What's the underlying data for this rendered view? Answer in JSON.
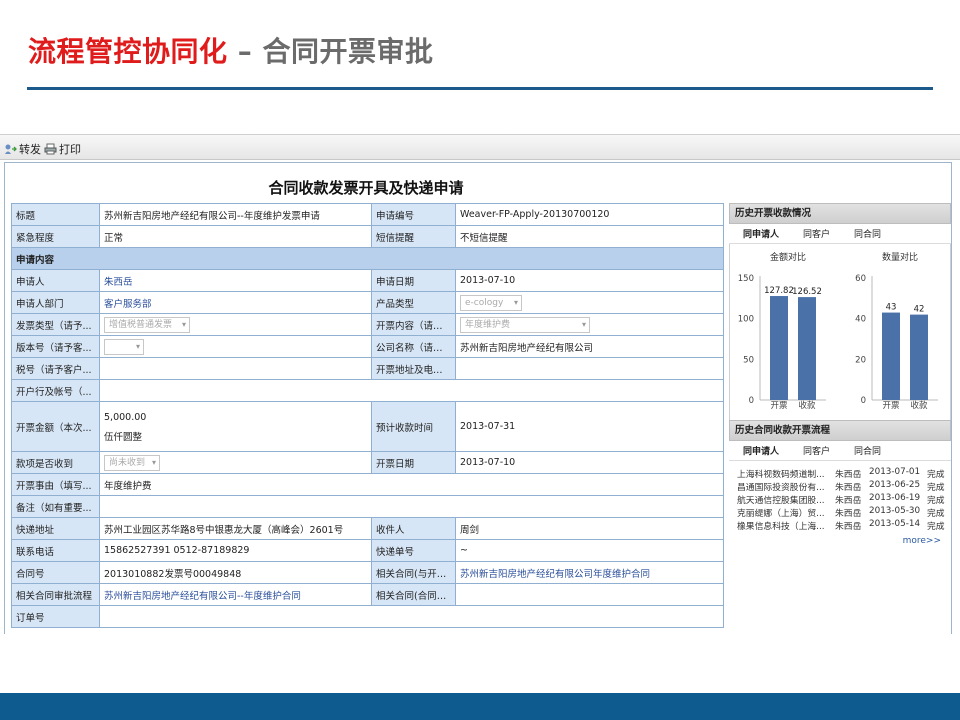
{
  "slide": {
    "title_red": "流程管控协同化",
    "title_gray": " – 合同开票审批"
  },
  "toolbar": {
    "forward_label": "转发",
    "print_label": "打印"
  },
  "form": {
    "title": "合同收款发票开具及快递申请",
    "rows": {
      "title_label": "标题",
      "title_value": "苏州新吉阳房地产经纪有限公司--年度维护发票申请",
      "req_no_label": "申请编号",
      "req_no_value": "Weaver-FP-Apply-20130700120",
      "urgency_label": "紧急程度",
      "urgency_value": "正常",
      "sms_label": "短信提醒",
      "sms_value": "不短信提醒",
      "section_label": "申请内容",
      "applicant_label": "申请人",
      "applicant_value": "朱西岳",
      "apply_date_label": "申请日期",
      "apply_date_value": "2013-07-10",
      "dept_label": "申请人部门",
      "dept_value": "客户服务部",
      "product_label": "产品类型",
      "product_value": "e-cology",
      "invoice_type_label": "发票类型（请予...",
      "invoice_type_value": "增值税普通发票",
      "invoice_content_label": "开票内容（请予...",
      "invoice_content_value": "年度维护费",
      "version_label": "版本号（请予客...",
      "company_label": "公司名称（请予...",
      "company_value": "苏州新吉阳房地产经纪有限公司",
      "tax_label": "税号（请予客户...",
      "address_label": "开票地址及电话...",
      "bank_label": "开户行及帐号（...",
      "amount_label": "开票金额（本次...",
      "amount_value": "5,000.00",
      "amount_words": "伍仟圆整",
      "expected_date_label": "预计收款时间",
      "expected_date_value": "2013-07-31",
      "received_label": "款项是否收到",
      "received_value": "尚未收到",
      "invoice_date_label": "开票日期",
      "invoice_date_value": "2013-07-10",
      "reason_label": "开票事由（填写...",
      "reason_value": "年度维护费",
      "note_label": "备注（如有重要...",
      "express_addr_label": "快递地址",
      "express_addr_value": "苏州工业园区苏华路8号中银惠龙大厦（高峰会）2601号",
      "receiver_label": "收件人",
      "receiver_value": "周剑",
      "phone_label": "联系电话",
      "phone_value": "15862527391 0512-87189829",
      "express_no_label": "快递单号",
      "express_no_value": "~",
      "contract_no_label": "合同号",
      "contract_no_value": "2013010882发票号00049848",
      "related_contract_label": "相关合同(与开票...",
      "related_contract_value": "苏州新吉阳房地产经纪有限公司年度维护合同",
      "related_flow_label": "相关合同审批流程",
      "related_flow_value": "苏州新吉阳房地产经纪有限公司--年度维护合同",
      "related_contract2_label": "相关合同(合同管...",
      "order_label": "订单号"
    }
  },
  "side": {
    "history_title": "历史开票收款情况",
    "tabs": [
      "同申请人",
      "同客户",
      "同合同"
    ],
    "flow_title": "历史合同收款开票流程",
    "flow_tabs": [
      "同申请人",
      "同客户",
      "同合同"
    ],
    "flow_rows": [
      {
        "name": "上海科视数码频道制...",
        "person": "朱西岳",
        "date": "2013-07-01",
        "status": "完成"
      },
      {
        "name": "昌通国际投资股份有...",
        "person": "朱西岳",
        "date": "2013-06-25",
        "status": "完成"
      },
      {
        "name": "航天通信控股集团股...",
        "person": "朱西岳",
        "date": "2013-06-19",
        "status": "完成"
      },
      {
        "name": "克丽缇娜（上海）贸...",
        "person": "朱西岳",
        "date": "2013-05-30",
        "status": "完成"
      },
      {
        "name": "橡果信息科技（上海...",
        "person": "朱西岳",
        "date": "2013-05-14",
        "status": "完成"
      }
    ],
    "more_label": "more>>"
  },
  "chart_data": [
    {
      "type": "bar",
      "title": "金额对比",
      "categories": [
        "开票",
        "收款"
      ],
      "values": [
        127.82,
        126.52
      ],
      "ylim": [
        0,
        150
      ],
      "yticks": [
        0,
        50,
        100,
        150
      ],
      "color": "#4a72a8"
    },
    {
      "type": "bar",
      "title": "数量对比",
      "categories": [
        "开票",
        "收款"
      ],
      "values": [
        43,
        42
      ],
      "ylim": [
        0,
        60
      ],
      "yticks": [
        0,
        20,
        40,
        60
      ],
      "color": "#4a72a8"
    }
  ]
}
